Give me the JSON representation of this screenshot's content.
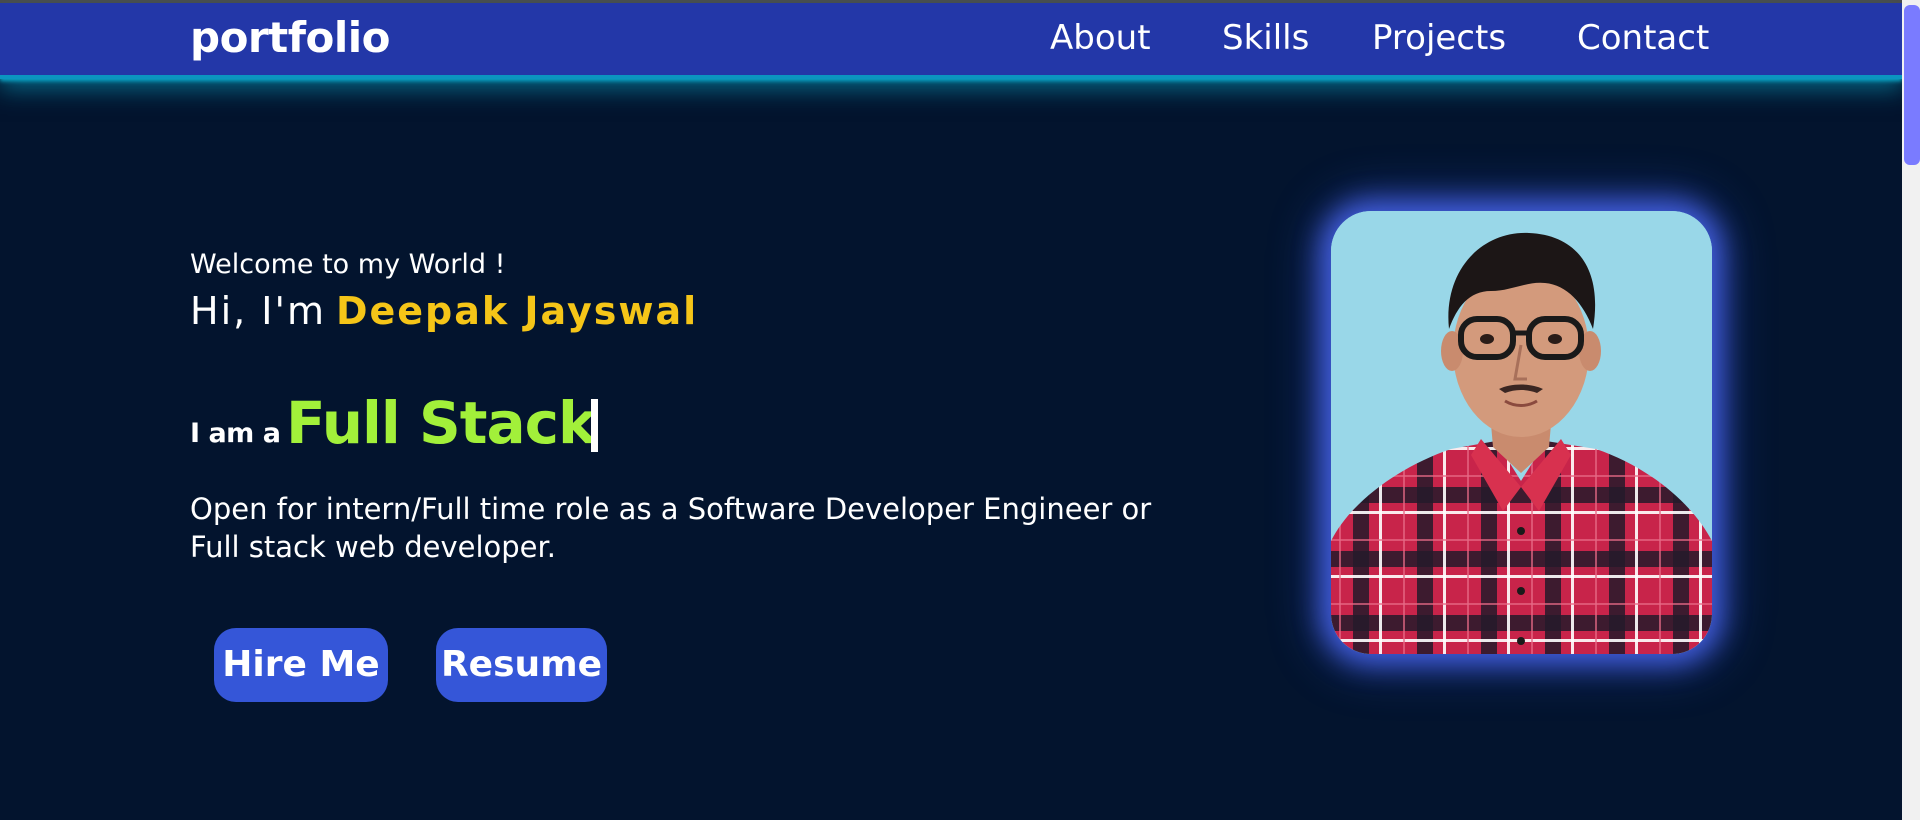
{
  "navbar": {
    "logo": "portfolio",
    "links": [
      "About",
      "Skills",
      "Projects",
      "Contact"
    ]
  },
  "hero": {
    "welcome": "Welcome to my World !",
    "greeting": "Hi, I'm",
    "name": "Deepak Jayswal",
    "iam_prefix": "I am a",
    "role": "Full Stack",
    "description": "Open for intern/Full time role as a Software Developer Engineer or Full stack web developer.",
    "buttons": {
      "hire": "Hire Me",
      "resume": "Resume"
    }
  },
  "colors": {
    "background": "#03142e",
    "navbar": "#2337a8",
    "nav_glow": "#0aa7c9",
    "name_accent": "#f5c518",
    "role_accent": "#a2f03a",
    "button": "#3556d8",
    "photo_background": "#99d7e8"
  }
}
